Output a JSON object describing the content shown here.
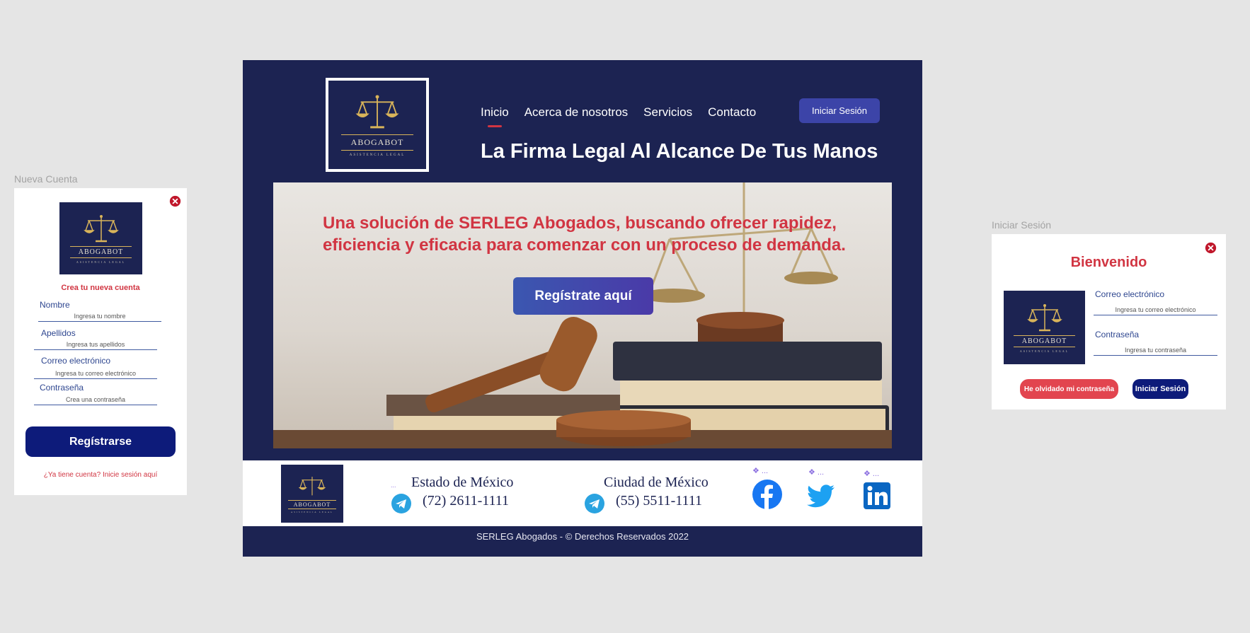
{
  "signup": {
    "frame_label": "Nueva Cuenta",
    "logo_name": "ABOGABOT",
    "logo_sub": "ASISTENCIA LEGAL",
    "heading": "Crea tu nueva cuenta",
    "fields": [
      {
        "label": "Nombre",
        "placeholder": "Ingresa tu nombre"
      },
      {
        "label": "Apellidos",
        "placeholder": "Ingresa tus apellidos"
      },
      {
        "label": "Correo electrónico",
        "placeholder": "Ingresa tu correo electrónico"
      },
      {
        "label": "Contraseña",
        "placeholder": "Crea una contraseña"
      }
    ],
    "register_label": "Regístrarse",
    "login_link": "¿Ya tiene cuenta? Inicie sesión aquí"
  },
  "site": {
    "logo_name": "ABOGABOT",
    "logo_sub": "ASISTENCIA LEGAL",
    "nav": [
      "Inicio",
      "Acerca de nosotros",
      "Servicios",
      "Contacto"
    ],
    "nav_active": "Inicio",
    "login_label": "Iniciar Sesión",
    "tagline": "La Firma Legal Al Alcance De Tus Manos",
    "hero_text": "Una solución de SERLEG Abogados, buscando ofrecer rapidez, eficiencia y eficacia para comenzar con un proceso de demanda.",
    "hero_button": "Regístrate aquí",
    "footer": {
      "state_1": "Estado de México",
      "phone_1": "(72) 2611-1111",
      "state_2": "Ciudad de México",
      "phone_2": "(55) 5511-1111",
      "copyright": "SERLEG Abogados - © Derechos Reservados 2022",
      "social": [
        "facebook-icon",
        "twitter-icon",
        "linkedin-icon"
      ]
    }
  },
  "login": {
    "frame_label": "Iniciar Sesión",
    "title": "Bienvenido",
    "logo_name": "ABOGABOT",
    "logo_sub": "ASISTENCIA LEGAL",
    "fields": [
      {
        "label": "Correo electrónico",
        "placeholder": "Ingresa tu correo electrónico"
      },
      {
        "label": "Contraseña",
        "placeholder": "Ingresa tu contraseña"
      }
    ],
    "forgot_label": "He olvidado mi contraseña",
    "submit_label": "Iniciar Sesión"
  },
  "colors": {
    "navy": "#1c2352",
    "accent_red": "#d13542",
    "button_navy": "#0d1b7a",
    "gold": "#d9b45a"
  }
}
